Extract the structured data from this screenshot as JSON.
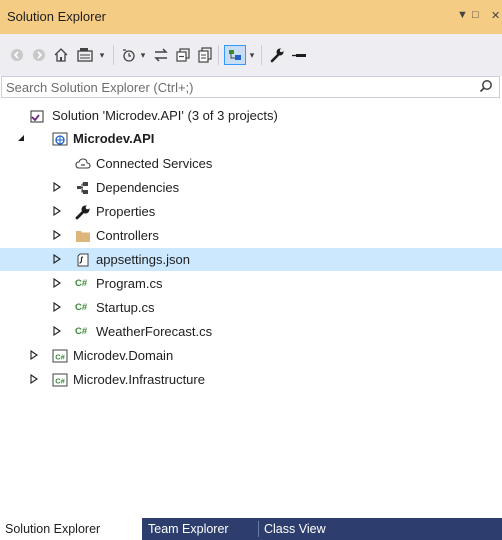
{
  "window": {
    "title": "Solution Explorer",
    "menu_glyph": "▼",
    "maximize_glyph": "□",
    "close_glyph": "✕"
  },
  "search": {
    "placeholder": "Search Solution Explorer (Ctrl+;)",
    "value": ""
  },
  "toolbar": {
    "icons": [
      "back-icon",
      "forward-icon",
      "home-icon",
      "switch-views-icon",
      "dropdown-icon",
      "pending-changes-filter-icon",
      "dropdown-icon",
      "sync-icon",
      "collapse-all-icon",
      "show-all-files-icon",
      "preview-selected-icon",
      "dropdown-icon",
      "properties-icon",
      "pin-icon"
    ]
  },
  "tree": {
    "solution": "Solution 'Microdev.API' (3 of 3 projects)",
    "project": "Microdev.API",
    "items": [
      {
        "label": "Connected Services",
        "icon": "connected-services-icon"
      },
      {
        "label": "Dependencies",
        "icon": "dependencies-icon"
      },
      {
        "label": "Properties",
        "icon": "wrench-icon"
      },
      {
        "label": "Controllers",
        "icon": "folder-icon"
      },
      {
        "label": "appsettings.json",
        "icon": "json-file-icon",
        "selected": true
      },
      {
        "label": "Program.cs",
        "icon": "csharp-file-icon"
      },
      {
        "label": "Startup.cs",
        "icon": "csharp-file-icon"
      },
      {
        "label": "WeatherForecast.cs",
        "icon": "csharp-file-icon"
      }
    ],
    "other_projects": [
      "Microdev.Domain",
      "Microdev.Infrastructure"
    ],
    "csharp_glyph": "C#"
  },
  "tabs": [
    {
      "label": "Solution Explorer",
      "active": true
    },
    {
      "label": "Team Explorer",
      "active": false
    },
    {
      "label": "Class View",
      "active": false
    }
  ],
  "colors": {
    "titlebar": "#f5cc84",
    "selection": "#cce8ff",
    "tabstrip": "#2d3e6e",
    "folder": "#dcb67a",
    "csharp": "#388a34"
  }
}
